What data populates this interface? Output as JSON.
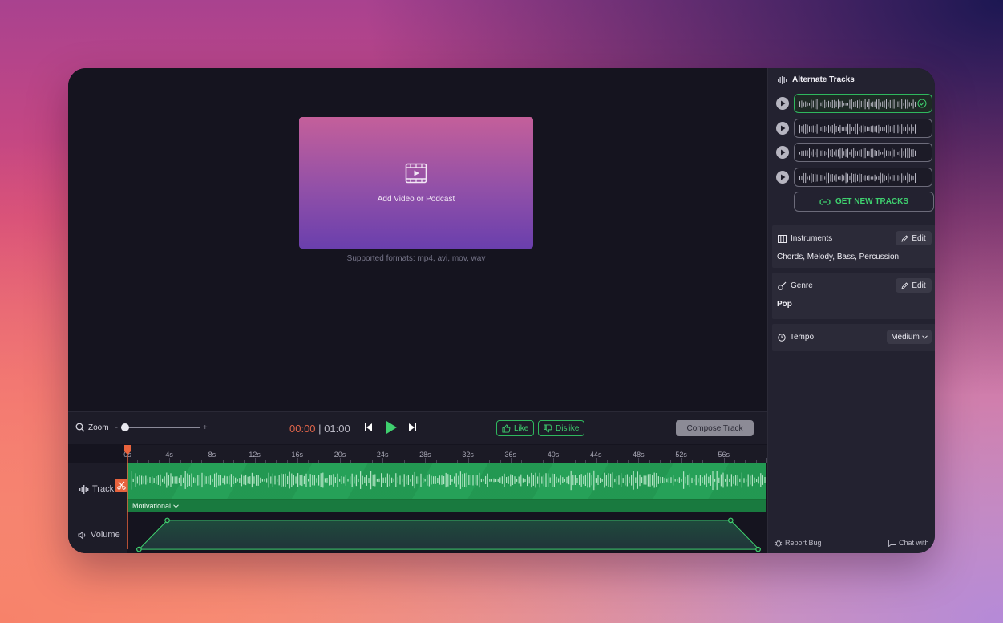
{
  "preview": {
    "drop_label": "Add Video or Podcast",
    "formats": "Supported formats: mp4, avi, mov, wav"
  },
  "transport": {
    "zoom_label": "Zoom",
    "zoom_minus": "-",
    "zoom_plus": "+",
    "zoom_level": 0,
    "current_time": "00:00",
    "separator": "|",
    "total_time": "01:00",
    "like_label": "Like",
    "dislike_label": "Dislike",
    "compose_label": "Compose Track"
  },
  "timeline": {
    "ticks": [
      "0s",
      "4s",
      "8s",
      "12s",
      "16s",
      "20s",
      "24s",
      "28s",
      "32s",
      "36s",
      "40s",
      "44s",
      "48s",
      "52s",
      "56s"
    ],
    "track_label": "Track",
    "clip_mood": "Motivational",
    "volume_label": "Volume",
    "colors": {
      "playhead": "#e8633d",
      "clip": "#1f8a49",
      "accent": "#3fd06f"
    }
  },
  "sidebar": {
    "title": "Alternate Tracks",
    "alternates": [
      {
        "selected": true,
        "icon": "check-circle-icon"
      },
      {
        "selected": false,
        "icon": ""
      },
      {
        "selected": false,
        "icon": ""
      },
      {
        "selected": false,
        "icon": ""
      }
    ],
    "get_new_label": "GET NEW TRACKS",
    "instruments": {
      "label": "Instruments",
      "edit": "Edit",
      "value": "Chords, Melody, Bass, Percussion"
    },
    "genre": {
      "label": "Genre",
      "edit": "Edit",
      "value": "Pop"
    },
    "tempo": {
      "label": "Tempo",
      "value": "Medium"
    },
    "report_bug": "Report Bug",
    "chat": "Chat with"
  }
}
